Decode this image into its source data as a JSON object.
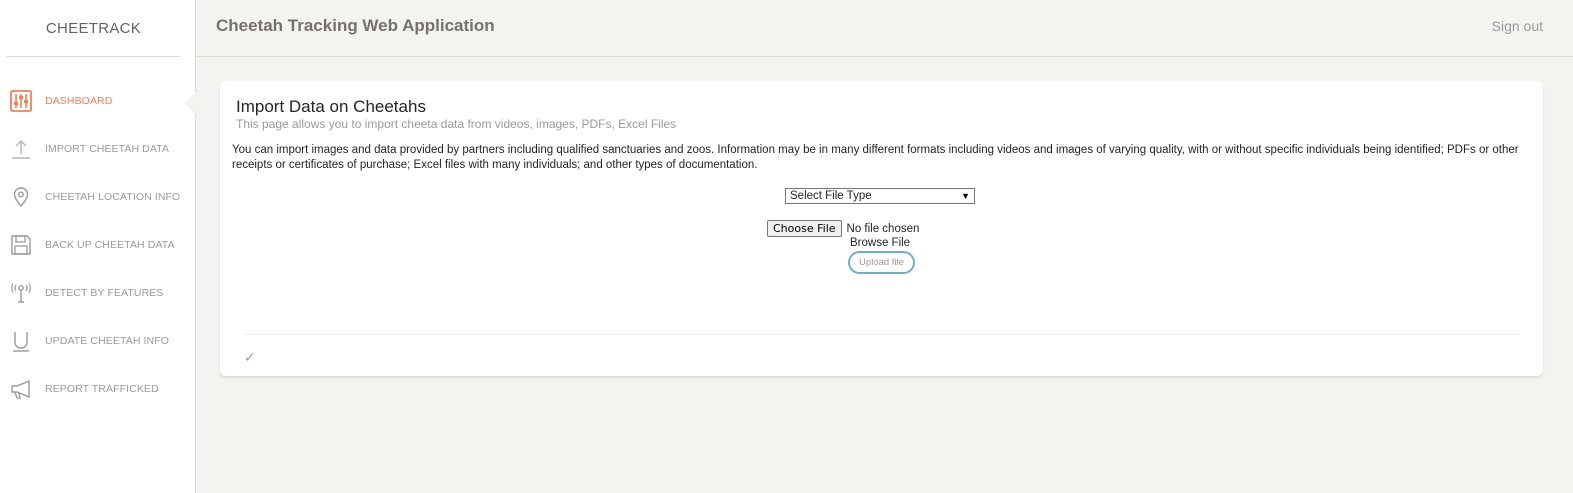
{
  "brand": "CHEETRACK",
  "app_title": "Cheetah Tracking Web Application",
  "signout_label": "Sign out",
  "sidebar": {
    "items": [
      {
        "label": "DASHBOARD",
        "icon": "sliders-icon",
        "active": true
      },
      {
        "label": "IMPORT CHEETAH DATA",
        "icon": "upload-icon",
        "active": false
      },
      {
        "label": "CHEETAH LOCATION INFO",
        "icon": "location-pin-icon",
        "active": false
      },
      {
        "label": "BACK UP CHEETAH DATA",
        "icon": "floppy-disk-icon",
        "active": false
      },
      {
        "label": "DETECT BY FEATURES",
        "icon": "antenna-icon",
        "active": false
      },
      {
        "label": "UPDATE CHEETAH INFO",
        "icon": "magnet-icon",
        "active": false
      },
      {
        "label": "REPORT TRAFFICKED",
        "icon": "megaphone-icon",
        "active": false
      }
    ]
  },
  "card": {
    "title": "Import Data on Cheetahs",
    "subtitle": "This page allows you to import cheeta data from videos, images, PDFs, Excel Files",
    "description": "You can import images and data provided by partners including qualified sanctuaries and zoos. Information may be in many different formats including videos and images of varying quality, with or without specific individuals being identified; PDFs or other receipts or certificates of purchase; Excel files with many individuals; and other types of documentation.",
    "file_type_select": "Select File Type",
    "choose_file_label": "Choose File",
    "no_file_text": "No file chosen",
    "browse_label": "Browse File",
    "upload_label": "Upload file",
    "footer_icon": "checkmark-icon"
  },
  "colors": {
    "accent": "#ef8157",
    "upload_border": "#68b3c8",
    "background": "#f4f3ef"
  }
}
